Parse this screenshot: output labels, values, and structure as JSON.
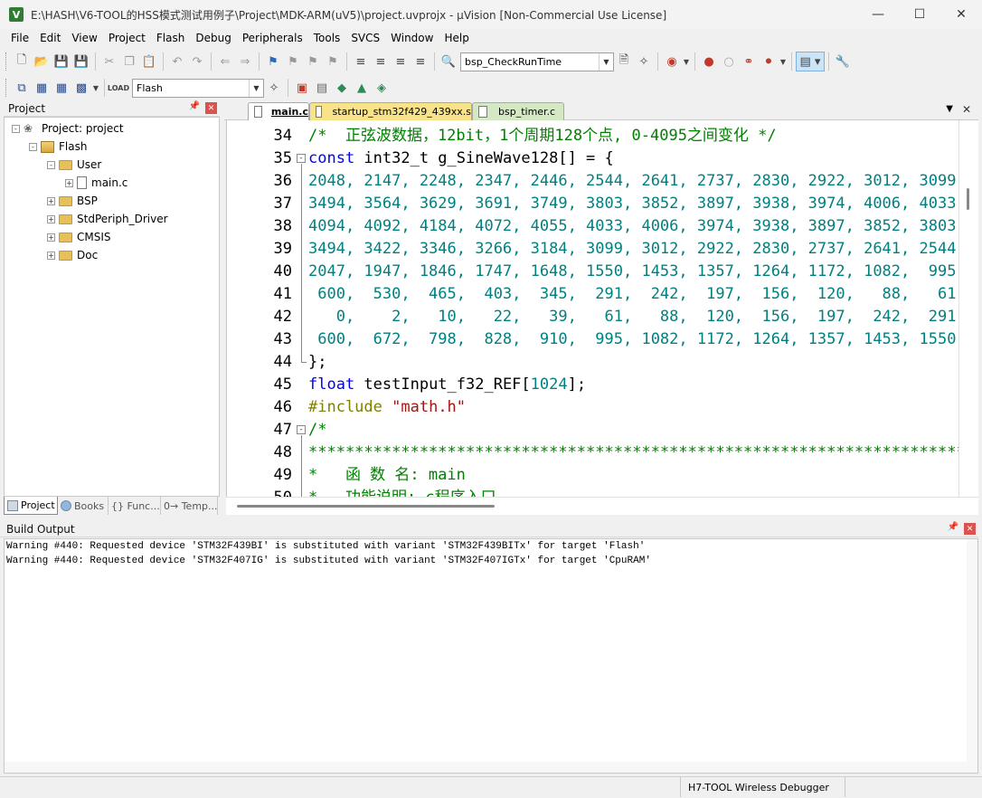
{
  "window": {
    "title": "E:\\HASH\\V6-TOOL的HSS模式测试用例子\\Project\\MDK-ARM(uV5)\\project.uvprojx - µVision  [Non-Commercial Use License]",
    "app_icon": "V"
  },
  "menu": [
    "File",
    "Edit",
    "View",
    "Project",
    "Flash",
    "Debug",
    "Peripherals",
    "Tools",
    "SVCS",
    "Window",
    "Help"
  ],
  "toolbar": {
    "find_combo": "bsp_CheckRunTime",
    "target_combo": "Flash"
  },
  "project_panel": {
    "title": "Project",
    "tree": [
      {
        "label": "Project: project",
        "type": "project",
        "expander": "-"
      },
      {
        "label": "Flash",
        "type": "target",
        "expander": "-"
      },
      {
        "label": "User",
        "type": "folder",
        "expander": "-"
      },
      {
        "label": "main.c",
        "type": "file",
        "expander": "+"
      },
      {
        "label": "BSP",
        "type": "folder",
        "expander": "+"
      },
      {
        "label": "StdPeriph_Driver",
        "type": "folder",
        "expander": "+"
      },
      {
        "label": "CMSIS",
        "type": "folder",
        "expander": "+"
      },
      {
        "label": "Doc",
        "type": "folder",
        "expander": "+"
      }
    ],
    "tabs": [
      "Project",
      "Books",
      "{} Func...",
      "0→ Temp..."
    ]
  },
  "editor": {
    "tabs": [
      "main.c",
      "startup_stm32f429_439xx.s",
      "bsp_timer.c"
    ],
    "lines": [
      {
        "num": "34",
        "fold": "",
        "parts": [
          [
            "c-comment",
            "/*  正弦波数据，12bit，1个周期128个点, 0-4095之间变化 */"
          ]
        ]
      },
      {
        "num": "35",
        "fold": "-",
        "parts": [
          [
            "c-keyword",
            "const"
          ],
          [
            "c-text",
            " int32_t g_SineWave128[] = {"
          ]
        ]
      },
      {
        "num": "36",
        "fold": "",
        "parts": [
          [
            "c-number",
            "2048, 2147, 2248, 2347, 2446, 2544, 2641, 2737, 2830, 2922, 3012, 3099,"
          ]
        ]
      },
      {
        "num": "37",
        "fold": "",
        "parts": [
          [
            "c-number",
            "3494, 3564, 3629, 3691, 3749, 3803, 3852, 3897, 3938, 3974, 4006, 4033,"
          ]
        ]
      },
      {
        "num": "38",
        "fold": "",
        "parts": [
          [
            "c-number",
            "4094, 4092, 4184, 4072, 4055, 4033, 4006, 3974, 3938, 3897, 3852, 3803,"
          ]
        ]
      },
      {
        "num": "39",
        "fold": "",
        "parts": [
          [
            "c-number",
            "3494, 3422, 3346, 3266, 3184, 3099, 3012, 2922, 2830, 2737, 2641, 2544,"
          ]
        ]
      },
      {
        "num": "40",
        "fold": "",
        "parts": [
          [
            "c-number",
            "2047, 1947, 1846, 1747, 1648, 1550, 1453, 1357, 1264, 1172, 1082,  995,"
          ]
        ]
      },
      {
        "num": "41",
        "fold": "",
        "parts": [
          [
            "c-number",
            " 600,  530,  465,  403,  345,  291,  242,  197,  156,  120,   88,   61,"
          ]
        ]
      },
      {
        "num": "42",
        "fold": "",
        "parts": [
          [
            "c-number",
            "   0,    2,   10,   22,   39,   61,   88,  120,  156,  197,  242,  291,"
          ]
        ]
      },
      {
        "num": "43",
        "fold": "",
        "parts": [
          [
            "c-number",
            " 600,  672,  798,  828,  910,  995, 1082, 1172, 1264, 1357, 1453, 1550,"
          ]
        ]
      },
      {
        "num": "44",
        "fold": "end",
        "parts": [
          [
            "c-text",
            "};"
          ]
        ]
      },
      {
        "num": "45",
        "fold": "",
        "parts": [
          [
            "c-keyword",
            "float"
          ],
          [
            "c-text",
            " testInput_f32_REF["
          ],
          [
            "c-number",
            "1024"
          ],
          [
            "c-text",
            "];"
          ]
        ]
      },
      {
        "num": "46",
        "fold": "",
        "parts": [
          [
            "c-prep",
            "#include"
          ],
          [
            "c-text",
            " "
          ],
          [
            "c-string",
            "\"math.h\""
          ]
        ]
      },
      {
        "num": "47",
        "fold": "-",
        "parts": [
          [
            "c-comment",
            "/*"
          ]
        ]
      },
      {
        "num": "48",
        "fold": "",
        "parts": [
          [
            "c-comment",
            "*************************************************************************"
          ]
        ]
      },
      {
        "num": "49",
        "fold": "",
        "parts": [
          [
            "c-comment",
            "*   函 数 名: main"
          ]
        ]
      },
      {
        "num": "50",
        "fold": "",
        "parts": [
          [
            "c-comment",
            "*   功能说明: c程序入口"
          ]
        ]
      }
    ]
  },
  "build_output": {
    "title": "Build Output",
    "lines": [
      "Warning #440: Requested device 'STM32F439BI' is substituted with variant 'STM32F439BITx' for target 'Flash'",
      "Warning #440: Requested device 'STM32F407IG' is substituted with variant 'STM32F407IGTx' for target 'CpuRAM'"
    ]
  },
  "status": {
    "debugger": "H7-TOOL Wireless Debugger"
  },
  "colors": {
    "comment": "#008000",
    "number": "#008080",
    "keyword": "#0000ff",
    "tab_active": "#ffffff",
    "tab_asm": "#f9e38a",
    "tab_timer": "#d5e8c4"
  }
}
